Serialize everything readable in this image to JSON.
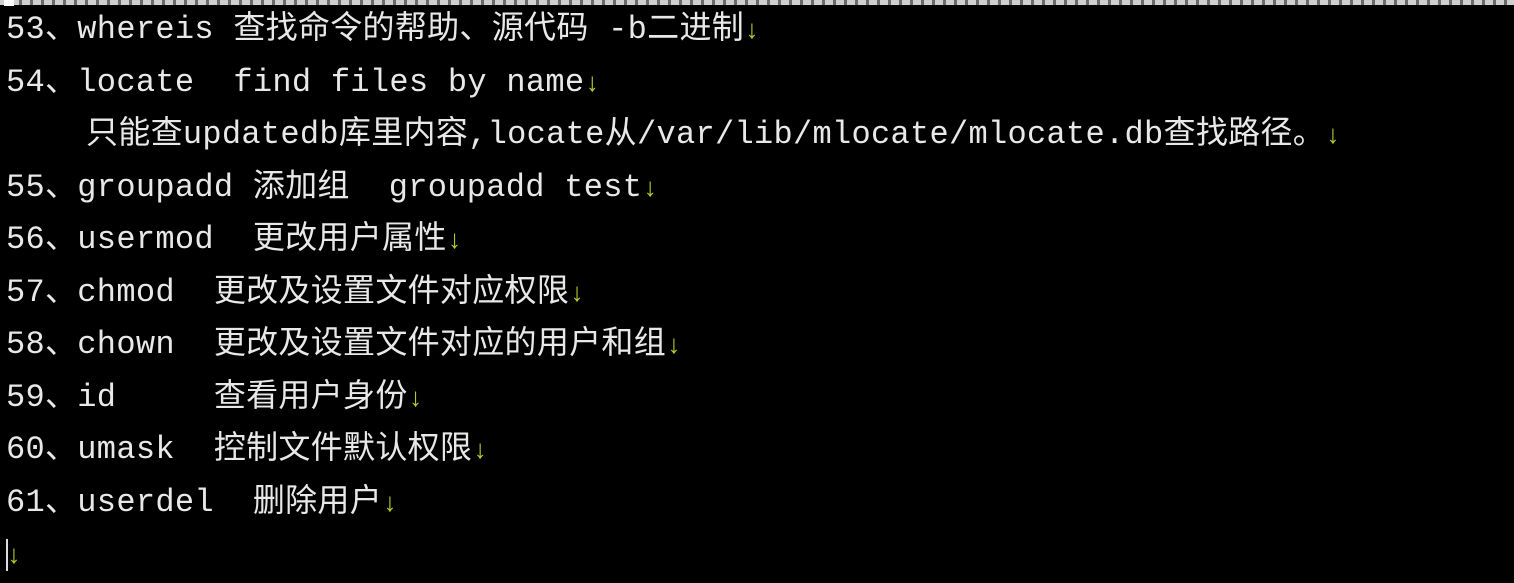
{
  "lines": [
    {
      "text": "53、whereis 查找命令的帮助、源代码 -b二进制"
    },
    {
      "text": "54、locate  find files by name"
    },
    {
      "text": "只能查updatedb库里内容,locate从/var/lib/mlocate/mlocate.db查找路径。"
    },
    {
      "text": "55、groupadd 添加组  groupadd test"
    },
    {
      "text": "56、usermod  更改用户属性"
    },
    {
      "text": "57、chmod  更改及设置文件对应权限"
    },
    {
      "text": "58、chown  更改及设置文件对应的用户和组"
    },
    {
      "text": "59、id     查看用户身份"
    },
    {
      "text": "60、umask  控制文件默认权限"
    },
    {
      "text": "61、userdel  删除用户"
    }
  ],
  "paragraph_mark": "↓",
  "colors": {
    "background": "#000000",
    "text": "#e8e8e8",
    "paragraph_mark": "#b8c82a"
  }
}
